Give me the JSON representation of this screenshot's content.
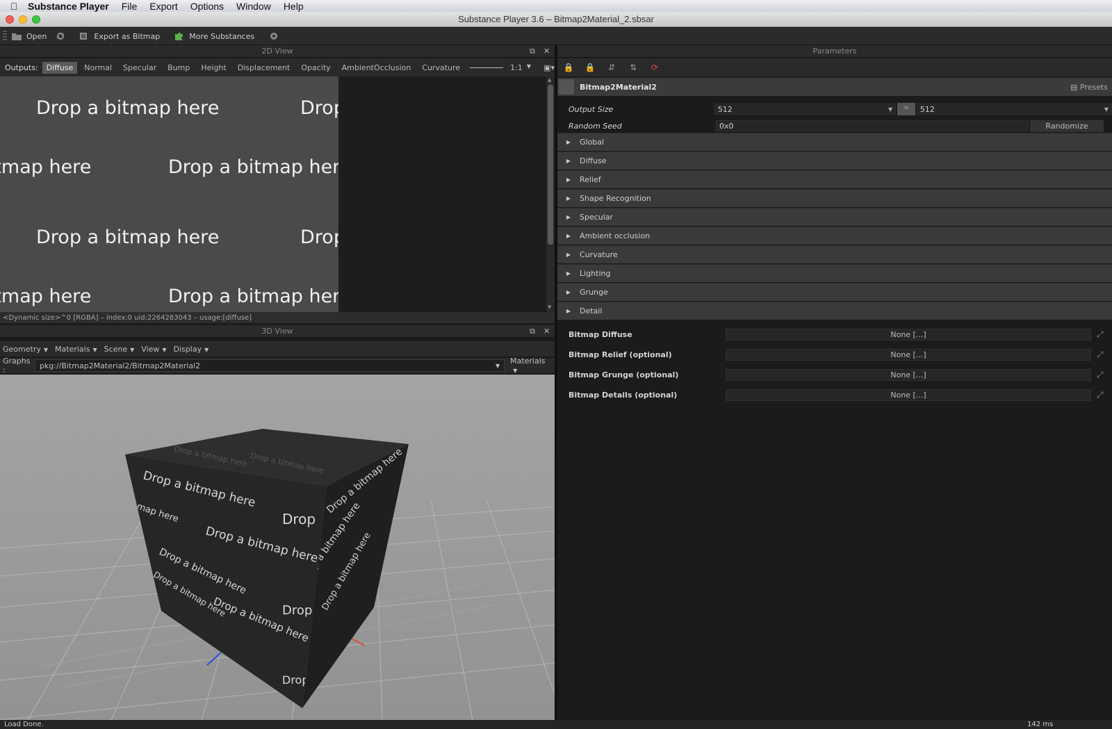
{
  "menubar": {
    "app": "Substance Player",
    "items": [
      "File",
      "Export",
      "Options",
      "Window",
      "Help"
    ]
  },
  "window": {
    "title": "Substance Player 3.6 – Bitmap2Material_2.sbsar"
  },
  "toolbar": {
    "open": "Open",
    "export": "Export as Bitmap",
    "more": "More Substances"
  },
  "view2d": {
    "title": "2D View",
    "outputs_label": "Outputs:",
    "tabs": [
      "Diffuse",
      "Normal",
      "Specular",
      "Bump",
      "Height",
      "Displacement",
      "Opacity",
      "AmbientOcclusion",
      "Curvature"
    ],
    "active_tab": "Diffuse",
    "zoom": "1:1",
    "drop_text": "Drop a bitmap here",
    "status": "<Dynamic size>^0 [RGBA] – index:0 uid:2264283043 – usage:[diffuse]"
  },
  "view3d": {
    "title": "3D View",
    "menus": [
      "Geometry",
      "Materials",
      "Scene",
      "View",
      "Display"
    ],
    "graphs_label": "Graphs :",
    "graph_path": "pkg://Bitmap2Material2/Bitmap2Material2",
    "materials_label": "Materials"
  },
  "params": {
    "title": "Parameters",
    "graph_name": "Bitmap2Material2",
    "presets": "Presets",
    "output_size_label": "Output Size",
    "output_size_w": "512",
    "output_size_h": "512",
    "seed_label": "Random Seed",
    "seed_value": "0x0",
    "randomize": "Randomize",
    "groups": [
      "Global",
      "Diffuse",
      "Relief",
      "Shape Recognition",
      "Specular",
      "Ambient occlusion",
      "Curvature",
      "Lighting",
      "Grunge",
      "Detail"
    ],
    "bitmaps": [
      {
        "label": "Bitmap Diffuse",
        "value": "None [...]"
      },
      {
        "label": "Bitmap Relief (optional)",
        "value": "None [...]"
      },
      {
        "label": "Bitmap Grunge (optional)",
        "value": "None [...]"
      },
      {
        "label": "Bitmap Details (optional)",
        "value": "None [...]"
      }
    ]
  },
  "status": {
    "message": "Load Done.",
    "time": "142 ms"
  },
  "colors": {
    "accent_red": "#d94a3c",
    "panel_bg": "#1b1b1b",
    "group_bg": "#3a3a3a"
  }
}
